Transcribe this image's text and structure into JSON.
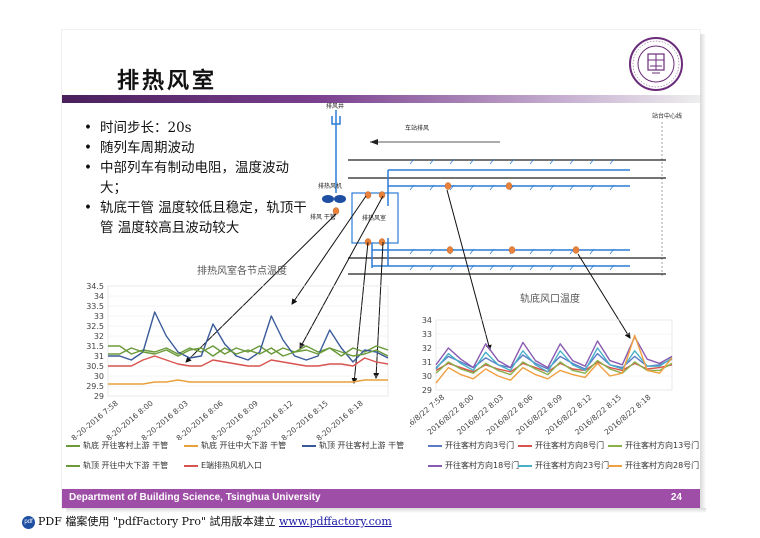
{
  "slide": {
    "title": "排热风室",
    "bullets": [
      "时间步长：20s",
      "随列车周期波动",
      "中部列车有制动电阻，温度波动大；",
      "轨底干管 温度较低且稳定，轨顶干管 温度较高且波动较大"
    ],
    "footer_dept": "Department of Building Science, Tsinghua University",
    "page_number": "24",
    "pdf_notice": "PDF 檔案使用 \"pdfFactory Pro\" 試用版本建立",
    "pdf_link": "www.pdffactory.com"
  },
  "diagram": {
    "shaft_label": "排风井",
    "station_line_label": "车站排风",
    "center_line_label": "站台中心线",
    "fan_label": "排热风机",
    "duct_label": "排风 干管",
    "room_label": "排热风室"
  },
  "colors": {
    "brand": "#9e4ea6",
    "duct": "#2b7bd6",
    "sensor": "#e8823a"
  },
  "chart_data": [
    {
      "type": "line",
      "title": "排热风室各节点温度",
      "categories": [
        "8-20-2016 7:58",
        "8-20-2016 8:00",
        "8-20-2016 8:03",
        "8-20-2016 8:06",
        "8-20-2016 8:09",
        "8-20-2016 8:12",
        "8-20-2016 8:15",
        "8-20-2016 8:18"
      ],
      "ylim": [
        29,
        34.5
      ],
      "yticks": [
        "29",
        "29.5",
        "30",
        "30.5",
        "31",
        "31.5",
        "32",
        "32.5",
        "33",
        "33.5",
        "34",
        "34.5"
      ],
      "legend_position": "bottom",
      "series": [
        {
          "name": "轨底 开往客村上游 干管",
          "color": "#6a9a3a",
          "values": [
            31.5,
            31.5,
            31.1,
            31.3,
            31.2,
            31.4,
            31.1,
            31.4,
            31.2,
            31.5,
            31.1,
            31.4,
            31.2,
            31.5,
            31.1,
            31.4,
            31.2,
            31.5,
            31.2,
            31.4,
            31.0,
            31.4,
            31.2,
            31.5,
            31.3
          ]
        },
        {
          "name": "轨底 开往中大下游 干管",
          "color": "#e8a03a",
          "values": [
            29.6,
            29.6,
            29.6,
            29.6,
            29.7,
            29.7,
            29.8,
            29.7,
            29.7,
            29.7,
            29.7,
            29.7,
            29.7,
            29.7,
            29.7,
            29.7,
            29.7,
            29.7,
            29.7,
            29.7,
            29.7,
            29.7,
            29.8,
            29.8,
            29.8
          ]
        },
        {
          "name": "轨顶 开往客村上游 干管",
          "color": "#3a5a9a",
          "values": [
            31.0,
            31.0,
            30.8,
            31.2,
            33.2,
            32.0,
            31.2,
            30.9,
            31.0,
            32.6,
            31.6,
            31.0,
            30.8,
            31.2,
            33.0,
            31.8,
            31.0,
            30.8,
            31.0,
            32.3,
            31.4,
            30.7,
            31.3,
            31.2,
            30.9
          ]
        },
        {
          "name": "轨顶 开往中大下游 干管",
          "color": "#6a9a3a",
          "values": [
            31.1,
            31.1,
            31.4,
            31.2,
            31.1,
            31.3,
            31.0,
            31.3,
            31.4,
            31.0,
            31.4,
            31.1,
            31.3,
            31.1,
            31.4,
            31.0,
            31.2,
            31.3,
            31.1,
            31.4,
            31.2,
            31.0,
            31.1,
            31.3,
            31.0
          ]
        },
        {
          "name": "E端排热风机入口",
          "color": "#d9534f",
          "values": [
            30.5,
            30.5,
            30.5,
            30.8,
            31.0,
            30.8,
            30.6,
            30.5,
            30.5,
            30.8,
            30.7,
            30.6,
            30.5,
            30.5,
            30.8,
            30.7,
            30.6,
            30.5,
            30.5,
            30.6,
            30.6,
            30.5,
            30.9,
            30.7,
            30.6
          ]
        }
      ]
    },
    {
      "type": "line",
      "title": "轨底风口温度",
      "categories": [
        "2016/8/22 7:58",
        "2016/8/22 8:00",
        "2016/8/22 8:03",
        "2016/8/22 8:06",
        "2016/8/22 8:09",
        "2016/8/22 8:12",
        "2016/8/22 8:15",
        "2016/8/22 8:18"
      ],
      "ylim": [
        29,
        34
      ],
      "yticks": [
        "29",
        "30",
        "31",
        "32",
        "33",
        "34"
      ],
      "legend_position": "bottom",
      "series": [
        {
          "name": "开往客村方向3号门",
          "color": "#5a7bc4",
          "values": [
            30.6,
            31.4,
            31.0,
            30.6,
            31.3,
            30.8,
            30.6,
            31.5,
            30.9,
            30.5,
            31.4,
            30.9,
            30.5,
            31.6,
            30.8,
            30.6,
            31.4,
            30.7,
            30.8,
            31.2
          ]
        },
        {
          "name": "开往客村方向8号门",
          "color": "#d9534f",
          "values": [
            30.4,
            30.9,
            30.6,
            30.3,
            30.8,
            30.5,
            30.3,
            30.9,
            30.6,
            30.3,
            30.9,
            30.5,
            30.4,
            31.0,
            30.6,
            30.4,
            30.9,
            30.5,
            30.6,
            30.8
          ]
        },
        {
          "name": "开往客村方向13号门",
          "color": "#8ab04a",
          "values": [
            30.2,
            31.0,
            30.5,
            30.2,
            30.9,
            30.4,
            30.1,
            31.0,
            30.5,
            30.1,
            31.0,
            30.4,
            30.2,
            31.1,
            30.5,
            30.2,
            31.0,
            30.4,
            30.4,
            30.9
          ]
        },
        {
          "name": "开往客村方向18号门",
          "color": "#8a5ab0",
          "values": [
            30.8,
            32.0,
            31.2,
            30.6,
            32.3,
            31.1,
            30.6,
            32.4,
            31.1,
            30.6,
            32.3,
            31.1,
            30.7,
            32.5,
            31.1,
            30.8,
            32.8,
            31.2,
            30.9,
            31.4
          ]
        },
        {
          "name": "开往客村方向23号门",
          "color": "#4ab0c8",
          "values": [
            30.5,
            31.6,
            30.9,
            30.4,
            31.7,
            30.8,
            30.4,
            31.8,
            30.8,
            30.3,
            31.8,
            30.8,
            30.4,
            32.0,
            30.8,
            30.5,
            31.8,
            30.7,
            30.7,
            31.3
          ]
        },
        {
          "name": "开往客村方向28号门",
          "color": "#f0a040",
          "values": [
            29.5,
            30.6,
            30.1,
            29.8,
            30.5,
            30.0,
            29.7,
            30.6,
            30.1,
            29.8,
            30.4,
            30.1,
            29.9,
            30.9,
            30.0,
            30.2,
            32.9,
            30.4,
            30.2,
            31.3
          ]
        }
      ]
    }
  ]
}
